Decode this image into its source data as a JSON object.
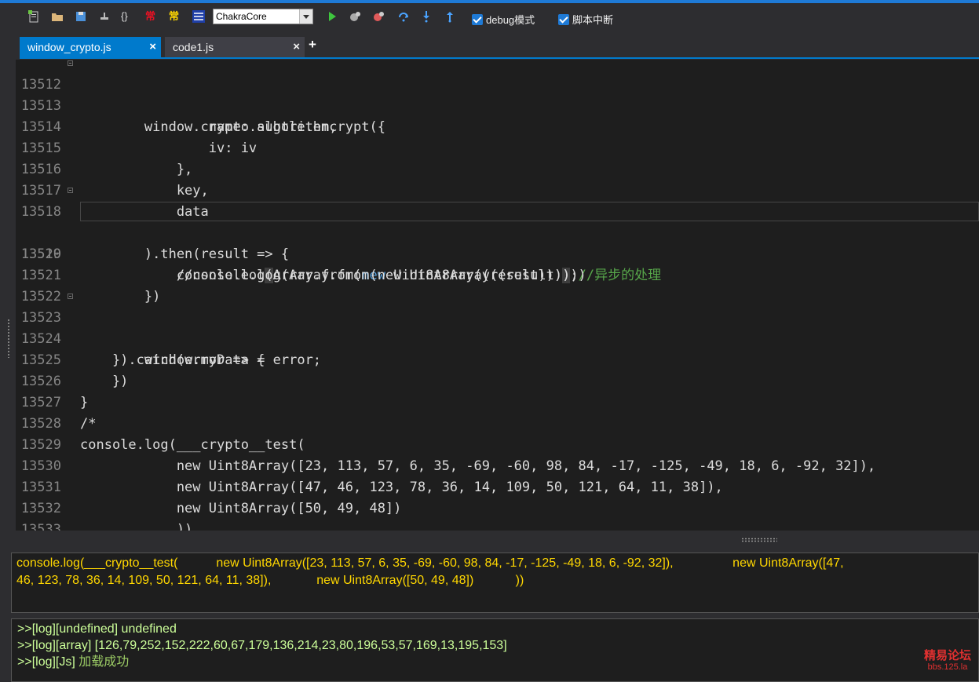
{
  "toolbar": {
    "chars": [
      "{}",
      "常",
      "常"
    ],
    "engine_value": "ChakraCore",
    "debug_label": "debug模式",
    "break_label": "脚本中断"
  },
  "tabs": [
    {
      "label": "window_crypto.js",
      "close": "×",
      "active": true
    },
    {
      "label": "code1.js",
      "close": "×",
      "active": false
    }
  ],
  "tab_add": "+",
  "editor": {
    "lines": [
      {
        "n": "13512",
        "text": "        window.crypto.subtle.encrypt({"
      },
      {
        "n": "13513",
        "text": "                name: algorithm,"
      },
      {
        "n": "13514",
        "text": "                iv: iv"
      },
      {
        "n": "13515",
        "text": "            },"
      },
      {
        "n": "13516",
        "text": "            key,"
      },
      {
        "n": "13517",
        "text": "            data"
      },
      {
        "n": "13518",
        "text": "        ).then(result => {"
      },
      {
        "n": "13519",
        "pre": "            console.log",
        "m1": "(",
        "mid1": "Array.from(",
        "kw": "new",
        "mid2": " Uint8Array((result)))",
        "m2": ")",
        "post": ";",
        "comment": "//异步的处理"
      },
      {
        "n": "13520",
        "text": "            //console.log(Array.from(new Uint8Array((result))))"
      },
      {
        "n": "13521",
        "text": "        })"
      },
      {
        "n": "13522",
        "text": ""
      },
      {
        "n": "13523",
        "text": "    }).catch(error => {"
      },
      {
        "n": "13524",
        "text": "        window.myData = error;"
      },
      {
        "n": "13525",
        "text": "    })"
      },
      {
        "n": "13526",
        "text": "}"
      },
      {
        "n": "13527",
        "text": "/*"
      },
      {
        "n": "13528",
        "text": "console.log(___crypto__test("
      },
      {
        "n": "13529",
        "text": "            new Uint8Array([23, 113, 57, 6, 35, -69, -60, 98, 84, -17, -125, -49, 18, 6, -92, 32]),"
      },
      {
        "n": "13530",
        "text": "            new Uint8Array([47, 46, 123, 78, 36, 14, 109, 50, 121, 64, 11, 38]),"
      },
      {
        "n": "13531",
        "text": "            new Uint8Array([50, 49, 48])"
      },
      {
        "n": "13532",
        "text": "            ))"
      },
      {
        "n": "13533",
        "text": "*/"
      }
    ]
  },
  "input_panel": {
    "line1": "console.log(___crypto__test(           new Uint8Array([23, 113, 57, 6, 35, -69, -60, 98, 84, -17, -125, -49, 18, 6, -92, 32]),                 new Uint8Array([47,",
    "line2": "46, 123, 78, 36, 14, 109, 50, 121, 64, 11, 38]),             new Uint8Array([50, 49, 48])            ))"
  },
  "output": {
    "line1": ">>[log][undefined] undefined",
    "line2": ">>[log][array] [126,79,252,152,222,60,67,179,136,214,23,80,196,53,57,169,13,195,153]",
    "line3_prefix": ">>[log][Js] ",
    "line3_text": "加载成功"
  },
  "watermark": {
    "line1": "精易论坛",
    "line2": "bbs.125.la"
  }
}
